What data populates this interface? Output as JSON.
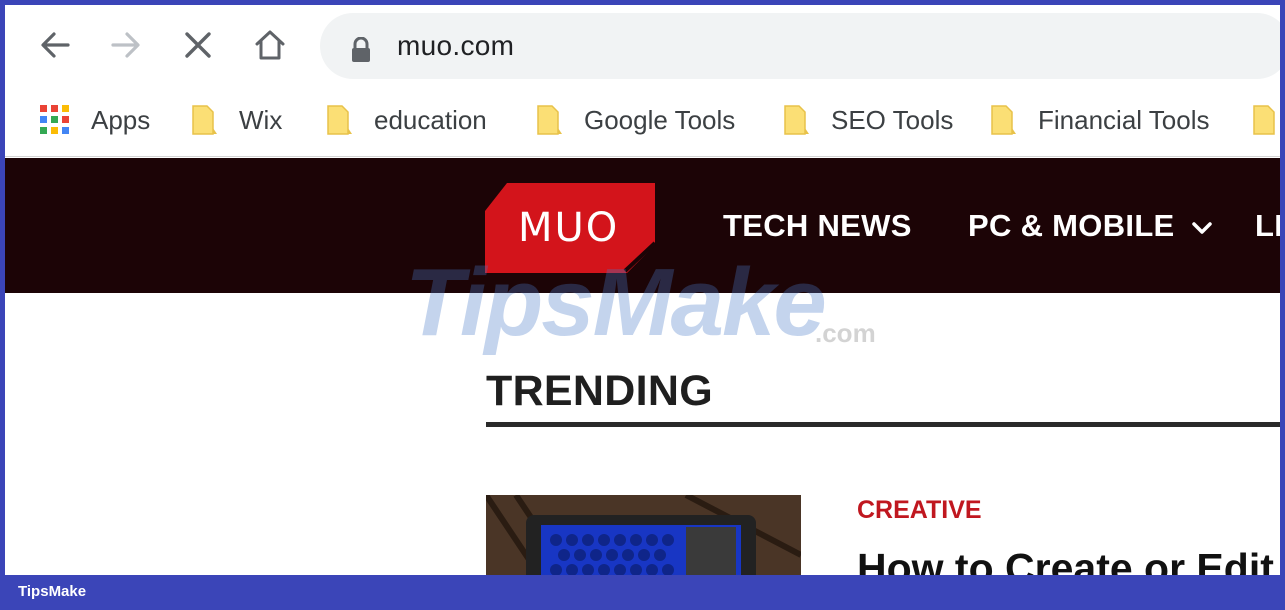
{
  "browser": {
    "url": "muo.com",
    "nav": {
      "back": "back-arrow-icon",
      "forward": "forward-arrow-icon",
      "stop": "close-icon",
      "home": "home-icon"
    }
  },
  "bookmarks": {
    "items": [
      {
        "label": "Apps",
        "icon": "apps-grid-icon"
      },
      {
        "label": "Wix",
        "icon": "folder-icon"
      },
      {
        "label": "education",
        "icon": "folder-icon"
      },
      {
        "label": "Google Tools",
        "icon": "folder-icon"
      },
      {
        "label": "SEO Tools",
        "icon": "folder-icon"
      },
      {
        "label": "Financial Tools",
        "icon": "folder-icon"
      }
    ]
  },
  "site": {
    "logo_text": "MUO",
    "nav": [
      {
        "label": "TECH NEWS"
      },
      {
        "label": "PC & MOBILE"
      },
      {
        "label": "LI"
      }
    ],
    "section_title": "TRENDING",
    "article": {
      "category": "CREATIVE",
      "headline": "How to Create or Edit"
    }
  },
  "watermark": {
    "text": "TipsMake",
    "suffix": ".com"
  },
  "footer": {
    "label": "TipsMake"
  },
  "colors": {
    "frame": "#3b45b8",
    "site_header": "#1c0406",
    "logo_red": "#d3141b",
    "category_red": "#c0171f",
    "folder_yellow": "#fbdf75"
  }
}
